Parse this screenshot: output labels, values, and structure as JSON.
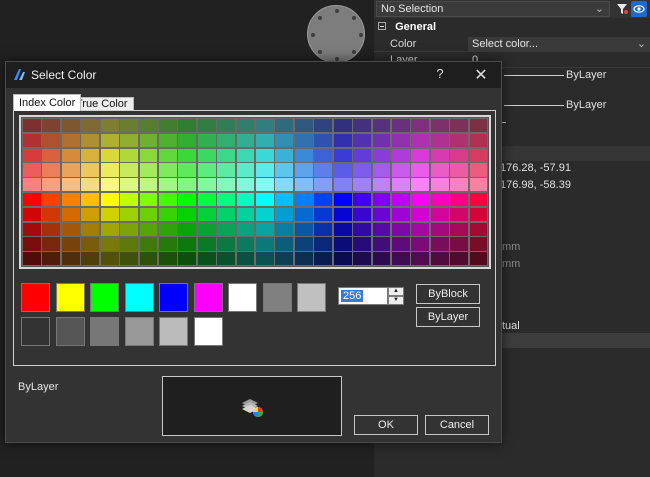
{
  "selection": {
    "value": "No Selection",
    "dropdown_icon": "chevron-down-icon"
  },
  "toolbar": {
    "filter_icon": "filter-icon",
    "quick_select_icon": "quick-select-icon"
  },
  "properties": {
    "section_title": "General",
    "color": {
      "label": "Color",
      "value": "Select color..."
    },
    "layer": {
      "label": "Layer",
      "value": "0"
    },
    "linetype_value": "ByLayer",
    "lineweight_value": "ByLayer",
    "coord_1": "176.28, -57.91",
    "coord_2": "176.98, -58.39",
    "unit_1": "mm",
    "unit_2": "mm",
    "partial_text": "tual"
  },
  "dialog": {
    "title": "Select Color",
    "help_label": "?",
    "close_label": "✕",
    "tabs": [
      {
        "label": "Index Color",
        "active": true
      },
      {
        "label": "True Color",
        "active": false
      }
    ],
    "palette": {
      "columns": 24,
      "rows": 10
    },
    "standard_colors": [
      "#ff0000",
      "#ffff00",
      "#00ff00",
      "#00ffff",
      "#0000ff",
      "#ff00ff",
      "#ffffff",
      "#808080",
      "#c0c0c0"
    ],
    "gray_colors": [
      "#333333",
      "#555555",
      "#777777",
      "#999999",
      "#bbbbbb",
      "#ffffff"
    ],
    "color_index": "256",
    "byblock_label": "ByBlock",
    "bylayer_label": "ByLayer",
    "status_label": "ByLayer",
    "ok_label": "OK",
    "cancel_label": "Cancel"
  }
}
